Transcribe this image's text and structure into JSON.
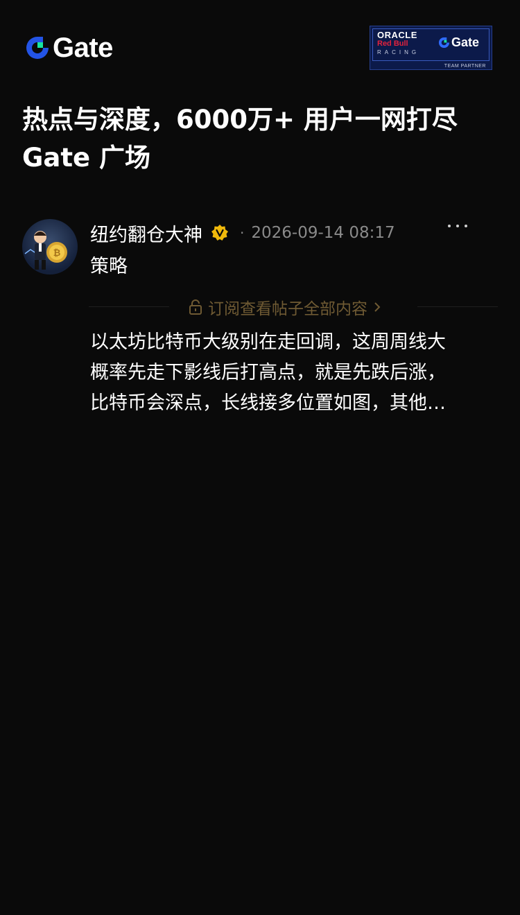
{
  "header": {
    "logo_text": "Gate",
    "partner": {
      "oracle": "ORACLE",
      "redbull": "Red Bull",
      "racing": "RACING",
      "gate": "Gate",
      "team_partner": "TEAM PARTNER"
    }
  },
  "headline": {
    "line1": "热点与深度，6000万+ 用户一网打尽",
    "line2": "Gate 广场"
  },
  "post": {
    "author": "纽约翻仓大神",
    "dot": "·",
    "timestamp": "2026-09-14 08:17",
    "tag": "策略",
    "subscribe_label": "订阅查看帖子全部内容",
    "content_lines": [
      "以太坊比特币大级别在走回调，这周周线大",
      "概率先走下影线后打高点，就是先跌后涨，",
      "比特币会深点，长线接多位置如图，其他…"
    ]
  },
  "colors": {
    "background": "#0a0a0a",
    "brand_blue": "#2354e6",
    "brand_green": "#17e6a1",
    "verified_gold": "#f0b90b",
    "subscribe_text": "#6f5a33",
    "muted": "#8a8a8a"
  },
  "icons": {
    "logo": "gate-logo-icon",
    "verified": "verified-badge-icon",
    "more": "more-icon",
    "lock": "lock-icon",
    "chevron": "chevron-right-icon"
  }
}
